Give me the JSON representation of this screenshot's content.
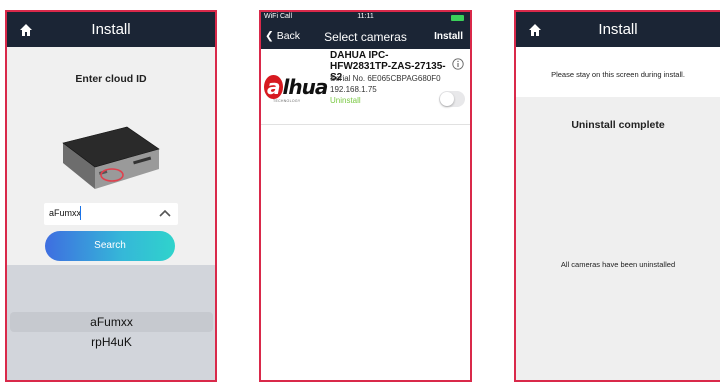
{
  "screen1": {
    "nav_title": "Install",
    "heading": "Enter cloud ID",
    "cloud_id_value": "aFumxx",
    "search_label": "Search",
    "picker_options": [
      "aFumxx",
      "rpH4uK"
    ],
    "picker_selected": "aFumxx"
  },
  "screen2": {
    "status": {
      "carrier": "WiFi Call",
      "time": "11:11"
    },
    "back_label": "Back",
    "title": "Select cameras",
    "install_label": "Install",
    "camera": {
      "brand_logo_text": "alhua",
      "brand_logo_subtext": "TECHNOLOGY",
      "model": "DAHUA IPC-HFW2831TP-ZAS-27135-S2",
      "serial": "Serial No. 6E065CBPAG680F0",
      "ip": "192.168.1.75",
      "status": "Uninstall",
      "toggle_on": false
    }
  },
  "screen3": {
    "nav_title": "Install",
    "notice": "Please stay on this screen during install.",
    "complete": "Uninstall complete",
    "all_uninstalled": "All cameras have been uninstalled"
  },
  "colors": {
    "navbar": "#1b2535",
    "frame_border": "#d9294a",
    "button_gradient_start": "#3e6ee0",
    "button_gradient_end": "#2fd3cc",
    "uninstall_green": "#7ac943",
    "dahua_red": "#d71920"
  }
}
